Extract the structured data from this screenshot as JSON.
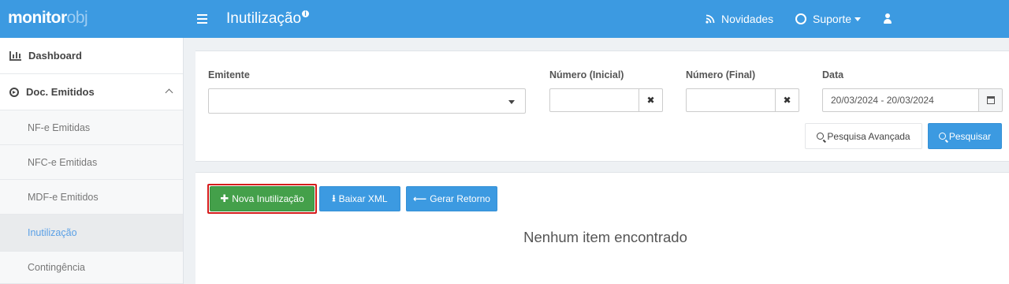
{
  "header": {
    "logo_main": "monitor",
    "logo_suffix": "obj",
    "page_title": "Inutilização",
    "title_badge": "i",
    "nav_news": "Novidades",
    "nav_support": "Suporte"
  },
  "sidebar": {
    "dashboard": "Dashboard",
    "docs": "Doc. Emitidos",
    "sub_items": [
      {
        "label": "NF-e Emitidas"
      },
      {
        "label": "NFC-e Emitidas"
      },
      {
        "label": "MDF-e Emitidos"
      },
      {
        "label": "Inutilização"
      },
      {
        "label": "Contingência"
      }
    ]
  },
  "filters": {
    "emitente_label": "Emitente",
    "numero_inicial_label": "Número (Inicial)",
    "numero_final_label": "Número (Final)",
    "data_label": "Data",
    "data_value": "20/03/2024 - 20/03/2024",
    "clear_symbol": "✖",
    "advanced_search": "Pesquisa Avançada",
    "search": "Pesquisar"
  },
  "actions": {
    "new": "Nova Inutilização",
    "download_xml": "Baixar XML",
    "generate_return": "Gerar Retorno"
  },
  "empty_message": "Nenhum item encontrado",
  "colors": {
    "primary": "#3c9ae1",
    "success": "#44a04a",
    "highlight": "#d51c1c",
    "active_link": "#5aa0e6"
  }
}
